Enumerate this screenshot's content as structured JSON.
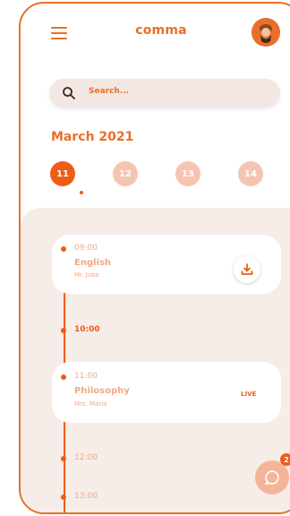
{
  "header": {
    "title": "comma",
    "menu_icon": "hamburger-menu-icon",
    "avatar_icon": "user-avatar"
  },
  "search": {
    "placeholder": "Search..."
  },
  "calendar": {
    "month": "March 2021",
    "dates": [
      "11",
      "12",
      "13",
      "14"
    ],
    "selected": "11"
  },
  "timeline": {
    "slots": [
      {
        "time": "09:00",
        "subject": "English",
        "teacher": "Mr. Jobo",
        "action_icon": "download-icon"
      },
      {
        "time": "10:00"
      },
      {
        "time": "11:00",
        "subject": "Philosophy",
        "teacher": "Mrs. Maria",
        "status": "LIVE"
      },
      {
        "time": "12:00"
      },
      {
        "time": "13:00"
      }
    ]
  },
  "chat": {
    "icon": "chat-bubble-icon",
    "badge_count": "2"
  },
  "colors": {
    "accent": "#ee5d17",
    "accent_light": "#f5c5b1",
    "panel_bg": "#f6ece8"
  }
}
